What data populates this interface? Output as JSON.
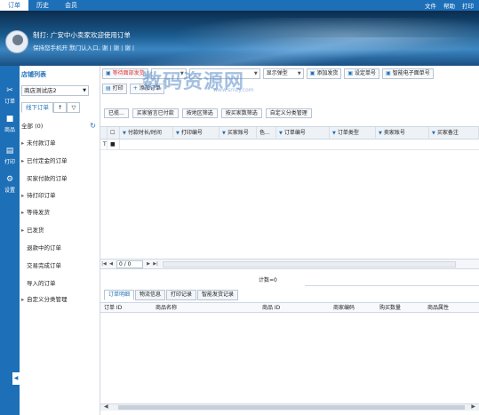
{
  "topbar": {
    "tabs": [
      "订单",
      "历史",
      "会员"
    ],
    "right": [
      "文件",
      "帮助",
      "打印"
    ]
  },
  "banner": {
    "line1": "制打: 广安中小卖家欢迎使用订单",
    "line2": "保持您手机开 默门认入口, 谢 | 谢 | 谢 |"
  },
  "leftnav": {
    "items": [
      {
        "label": "订单",
        "icon": "scissors-icon"
      },
      {
        "label": "商品",
        "icon": "box-icon"
      },
      {
        "label": "打印",
        "icon": "printer-icon"
      },
      {
        "label": "设置",
        "icon": "gear-icon"
      }
    ]
  },
  "leftpanel": {
    "title": "店铺列表",
    "shop_select": "商店测试店2",
    "tabs": [
      "线下订单",
      "↑",
      "▽"
    ],
    "all_label": "全部 (0)",
    "items": [
      "未付款订单",
      "已付定金的订单",
      "买家付款的订单",
      "待打印订单",
      "等待发货",
      "已发货",
      "退款中的订单",
      "交易完成订单",
      "导入的订单",
      "自定义分类管理"
    ]
  },
  "toolbar": {
    "row1": [
      {
        "type": "button",
        "label": "等待面部发货",
        "red": true
      },
      {
        "type": "select",
        "label": ""
      },
      {
        "type": "select",
        "label": ""
      },
      {
        "type": "select",
        "label": "显示弹型"
      },
      {
        "type": "button",
        "label": "添加发货"
      },
      {
        "type": "button",
        "label": "设定单号"
      },
      {
        "type": "button",
        "label": "智能电子面单号"
      }
    ],
    "row2": [
      {
        "type": "button",
        "label": "打印"
      },
      {
        "type": "button",
        "label": "添加订单"
      }
    ],
    "filters": [
      "已揽...",
      "买家留言已付款",
      "按地区筛选",
      "按买家数筛选",
      "自定义分类管理"
    ]
  },
  "grid": {
    "headers": [
      "付款时长/时间",
      "打印编号",
      "买家账号",
      "色...",
      "订单编号",
      "订单类型",
      "卖家账号",
      "买家备注"
    ],
    "first_row_marker": "T"
  },
  "pager": {
    "page": "0 / 0"
  },
  "count": {
    "label": "计数=0"
  },
  "bottom": {
    "tabs": [
      "订单明细",
      "物流信息",
      "打印记录",
      "智能发货记录"
    ],
    "headers": [
      "订单 ID",
      "商品名称",
      "商品 ID",
      "商家编码",
      "购买数量",
      "商品属性"
    ]
  },
  "watermark": {
    "text": "数码资源网",
    "sub": "www.smzy.com"
  }
}
